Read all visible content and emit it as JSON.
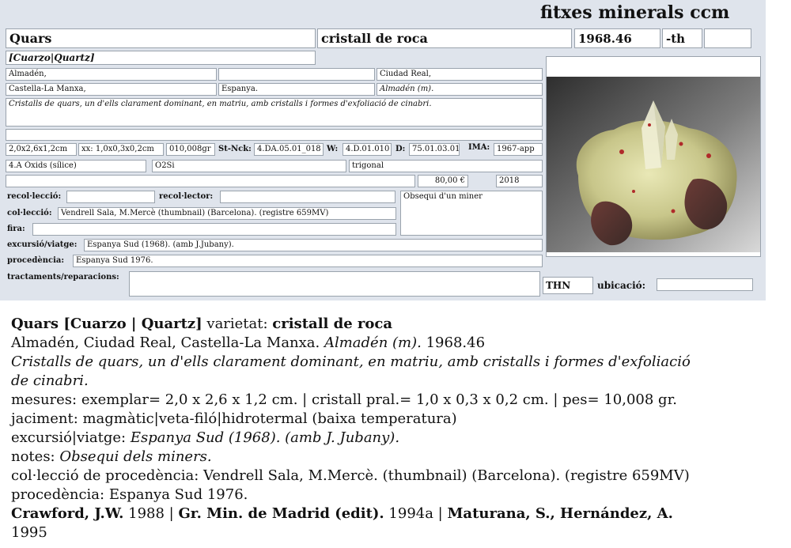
{
  "card": {
    "title": "fitxes minerals ccm",
    "name": "Quars",
    "variety": "cristall de roca",
    "number": "1968.46",
    "suffix": "-th",
    "extra": "",
    "synonyms": "[Cuarzo|Quartz]",
    "locality1": "Almadén,",
    "locality2": "",
    "locality3": "Ciudad Real,",
    "region": "Castella-La Manxa,",
    "country": "Espanya.",
    "mine": "Almadén (m).",
    "description": "Cristalls de quars, un d'ells clarament dominant, en matriu, amb cristalls i formes d'exfoliació de cinabri.",
    "blank_row": "",
    "size": "2,0x2,6x1,2cm",
    "crystal": "xx: 1,0x0,3x0,2cm",
    "weight": "010,008gr",
    "stnck_label": "St-Nck:",
    "stnck": "4.DA.05.01_018",
    "w_label": "W:",
    "w": "4.D.01.010",
    "d_label": "D:",
    "d": "75.01.03.01",
    "ima_label": "IMA:",
    "ima": "1967-app",
    "class": "4.A Òxids (sílice)",
    "formula": "O2Si",
    "system": "trigonal",
    "price_blank": "",
    "price": "80,00 €",
    "year": "2018",
    "recollection_label": "recol·lecció:",
    "recollection": "",
    "collector_label": "recol·lector:",
    "collector": "",
    "notes": "Obsequi d'un miner",
    "collection_label": "col·lecció:",
    "collection": "Vendrell Sala, M.Mercè (thumbnail) (Barcelona). (registre 659MV)",
    "fair_label": "fira:",
    "fair": "",
    "excursion_label": "excursió/viatge:",
    "excursion": "Espanya Sud (1968). (amb J.Jubany).",
    "provenance_label": "procedència:",
    "provenance": "Espanya Sud 1976.",
    "treatments_label": "tractaments/reparacions:",
    "treatments": "",
    "thn": "THN",
    "location_label": "ubicació:",
    "location": ""
  },
  "summary": {
    "l1_name": "Quars [Cuarzo | Quartz]",
    "l1_variety_label": " varietat: ",
    "l1_variety": "cristall de roca",
    "l2_locality": "Almadén, Ciudad Real, Castella-La Manxa. ",
    "l2_mine": "Almadén (m).",
    "l2_number": " 1968.46",
    "l3": "Cristalls de quars, un d'ells clarament dominant, en matriu, amb cristalls i formes d'exfoliació",
    "l4": "de cinabri.",
    "l5": "mesures: exemplar= 2,0 x 2,6 x 1,2 cm. | cristall pral.= 1,0 x 0,3 x 0,2 cm. | pes= 10,008 gr.",
    "l6": "jaciment: magmàtic|veta-filó|hidrotermal (baixa temperatura)",
    "l7_label": "excursió|viatge: ",
    "l7_value": "Espanya Sud (1968). (amb J. Jubany).",
    "l8_label": "notes: ",
    "l8_value": "Obsequi dels miners.",
    "l9": "col·lecció de procedència: Vendrell Sala, M.Mercè. (thumbnail) (Barcelona). (registre 659MV)",
    "l10": "procedència: Espanya Sud 1976.",
    "l11_author1": "Crawford, J.W.",
    "l11_year1": " 1988 | ",
    "l11_author2": "Gr. Min. de Madrid (edit).",
    "l11_year2": " 1994a | ",
    "l11_author3": "Maturana, S., Hernández, A.",
    "l12": "1995"
  },
  "photo": {
    "subject": "quartz-crystal-specimen-photo"
  }
}
